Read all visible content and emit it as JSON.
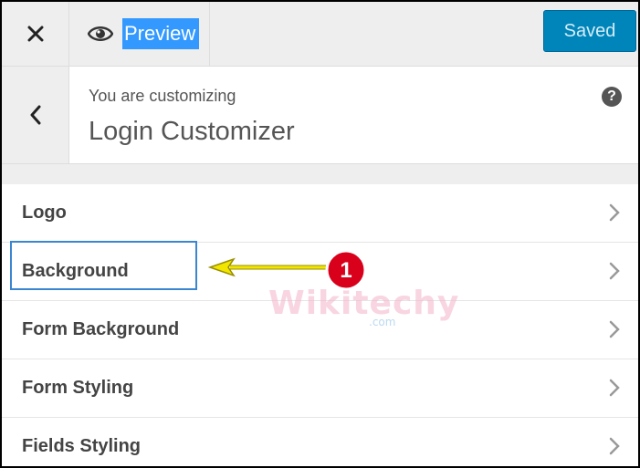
{
  "toolbar": {
    "close_icon": "close-icon",
    "preview_label": "Preview",
    "preview_icon": "eye-icon",
    "saved_label": "Saved"
  },
  "header": {
    "back_icon": "chevron-left-icon",
    "subtitle": "You are customizing",
    "title": "Login Customizer",
    "help_icon": "?"
  },
  "menu": {
    "items": [
      {
        "label": "Logo"
      },
      {
        "label": "Background"
      },
      {
        "label": "Form Background"
      },
      {
        "label": "Form Styling"
      },
      {
        "label": "Fields Styling"
      }
    ]
  },
  "annotation": {
    "badge_number": "1",
    "arrow_color": "#f2e600",
    "badge_color": "#d9001b"
  },
  "watermark": {
    "text": "Wikitechy",
    "suffix": ".com"
  },
  "colors": {
    "accent": "#0085ba",
    "highlight": "#3399ff"
  }
}
